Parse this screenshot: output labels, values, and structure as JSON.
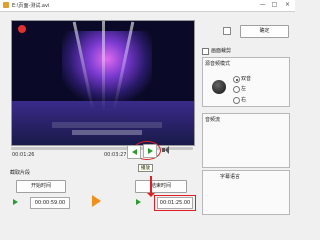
{
  "window": {
    "title": "E:\\页面-测试.avi",
    "controls": [
      "—",
      "□",
      "×"
    ]
  },
  "player": {
    "current_time": "00:01:26",
    "end_time": "00:03:27",
    "play_tooltip": "播放"
  },
  "clip": {
    "section_label": "截取片段",
    "start_button": "开始时间",
    "end_button": "结束时间",
    "start_value": "00:00:59.00",
    "end_value": "00:01:25.00"
  },
  "side": {
    "ok_button": "确定",
    "checkbox_label": "画面裁剪",
    "channel_group_label": "源音频模式",
    "channel_options": [
      "双音",
      "左",
      "右"
    ],
    "channel_selected": 0,
    "group2_label": "音频流",
    "group3_label": "字幕语言"
  },
  "colors": {
    "accent_green": "#2a9d2a",
    "highlight_red": "#e02020",
    "arrow_orange": "#f0901a"
  }
}
